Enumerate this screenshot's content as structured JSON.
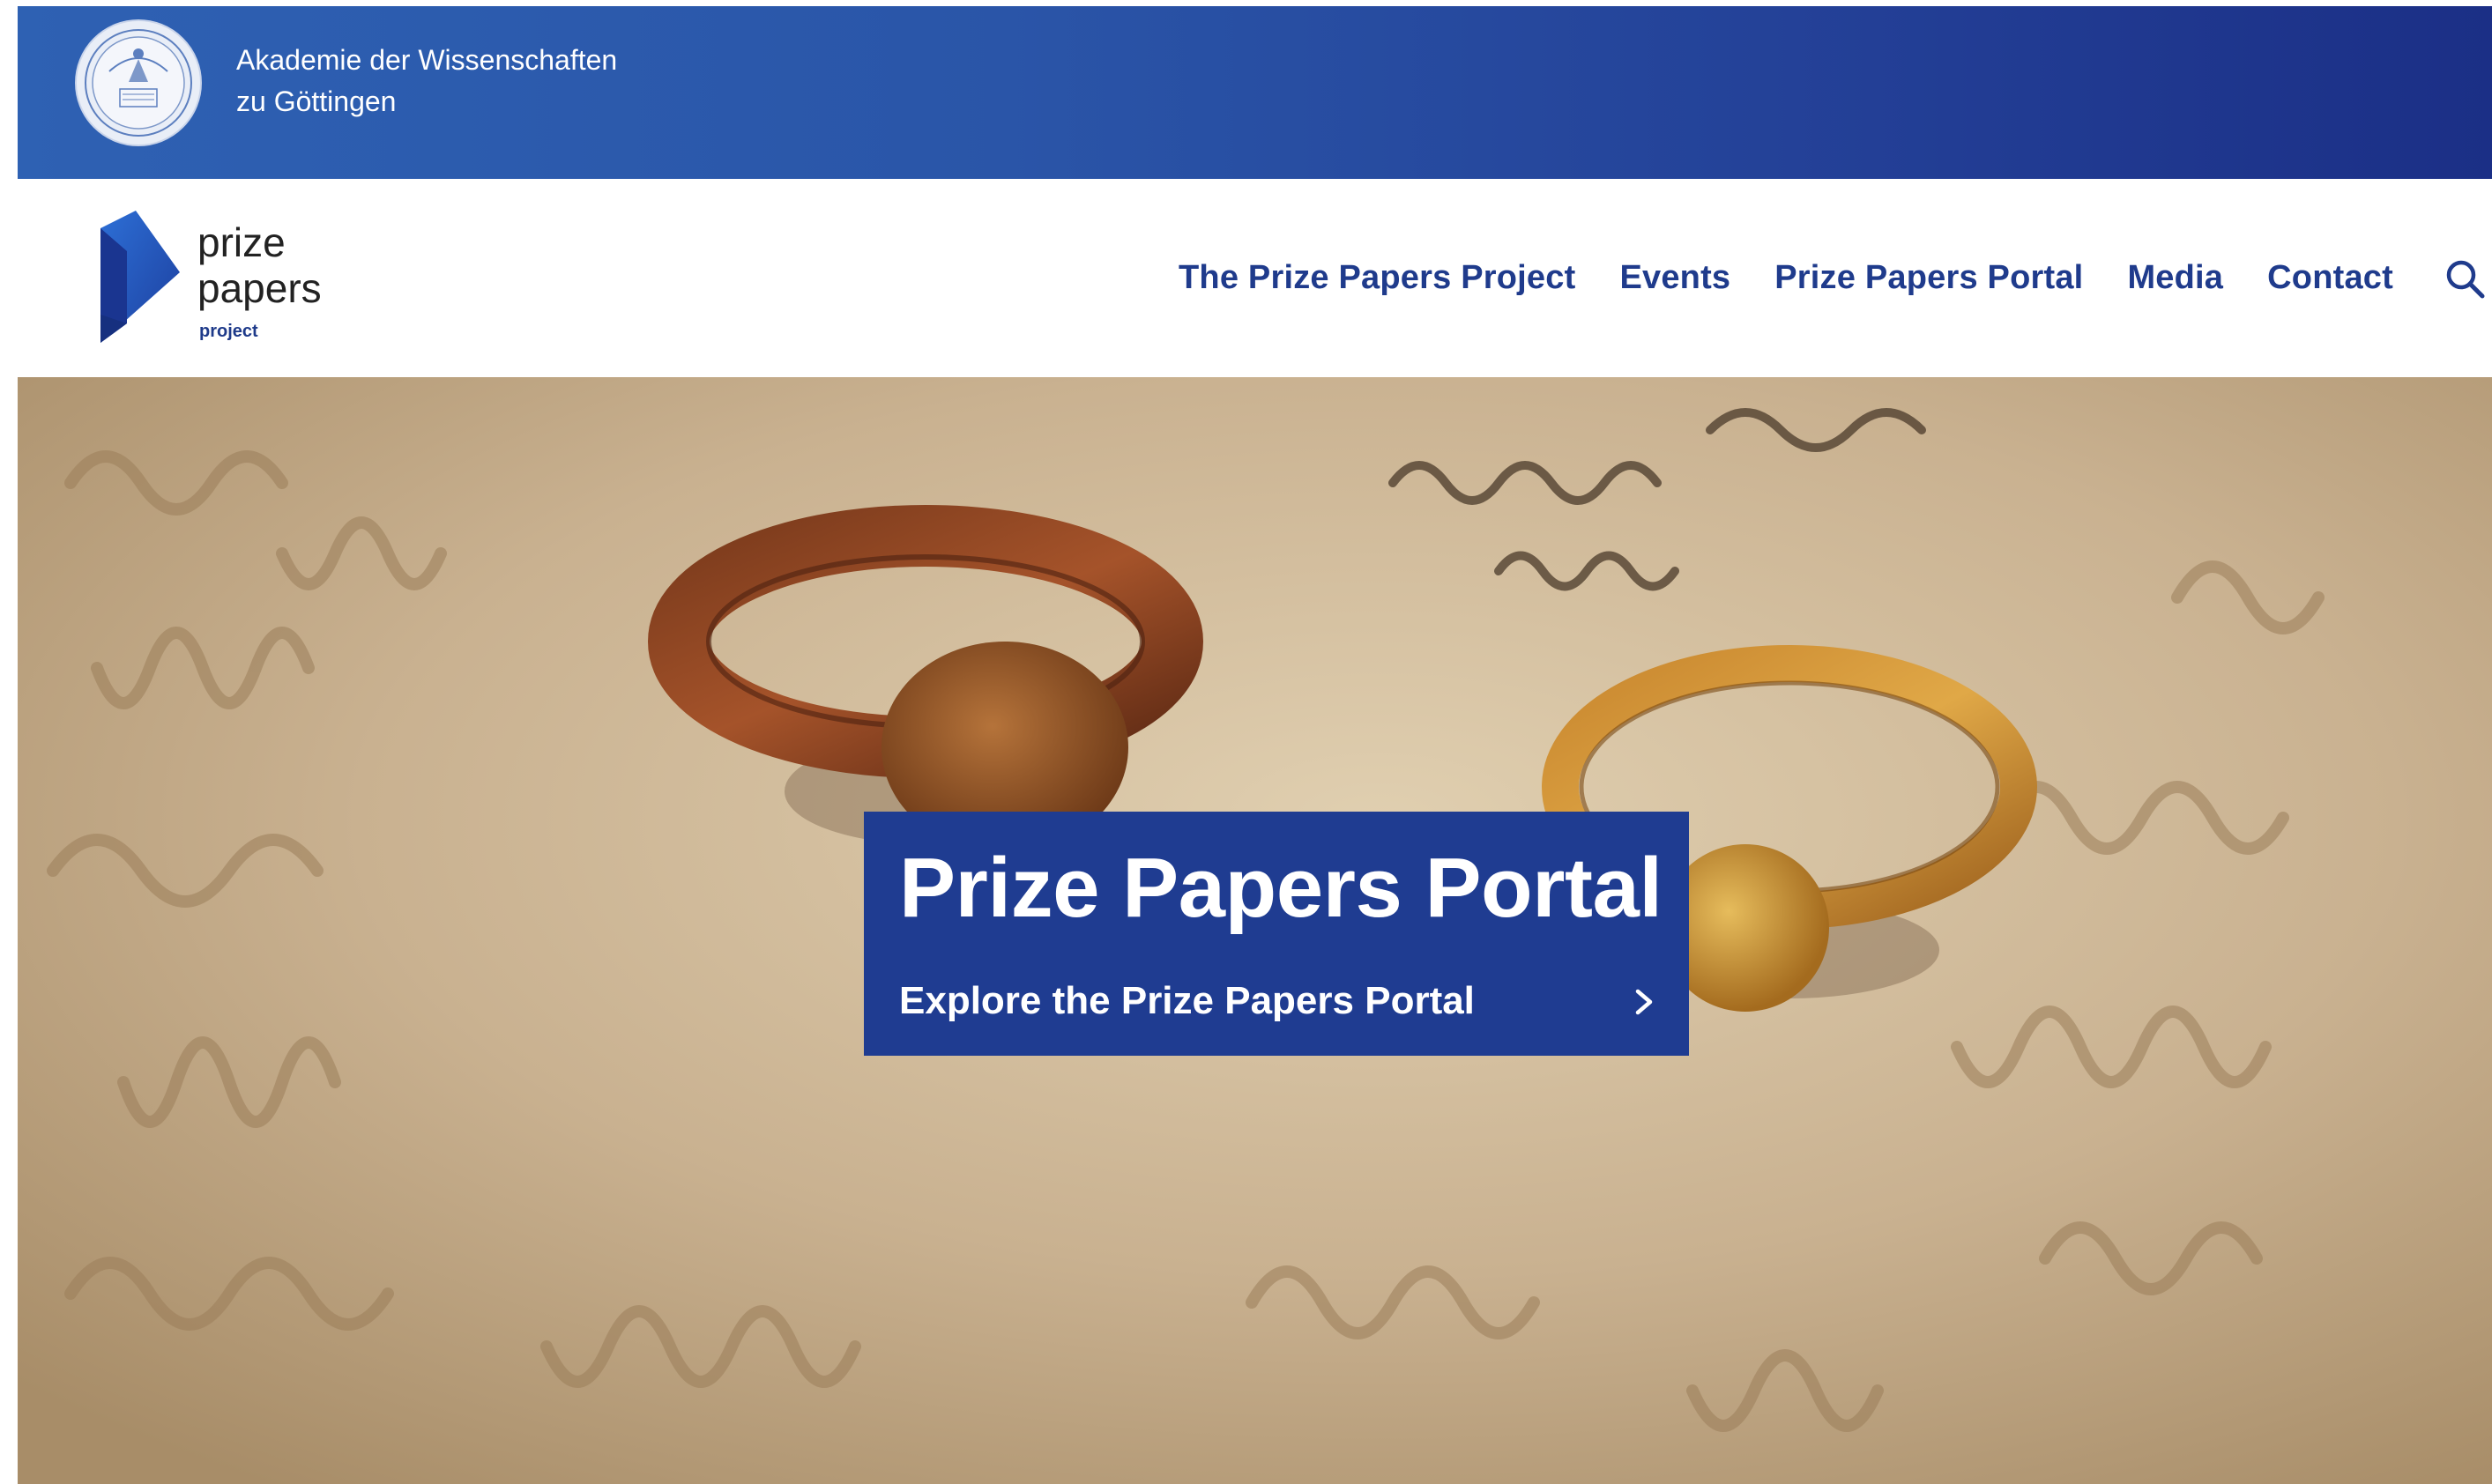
{
  "academy_bar": {
    "name_line1": "Akademie der Wissenschaften",
    "name_line2": "zu Göttingen",
    "seal_icon": "academy-seal-icon",
    "gradient_start": "#2e61b3",
    "gradient_end": "#1b2f86"
  },
  "header": {
    "logo": {
      "word_line1": "prize",
      "word_line2": "papers",
      "sub": "project",
      "mark_icon": "prize-papers-logo-mark"
    },
    "nav": [
      {
        "label": "The Prize Papers Project"
      },
      {
        "label": "Events"
      },
      {
        "label": "Prize Papers Portal"
      },
      {
        "label": "Media"
      },
      {
        "label": "Contact"
      }
    ],
    "search_icon": "search-icon",
    "nav_color": "#1f3b8c"
  },
  "hero": {
    "image_subject": "two-rings-on-handwritten-letter",
    "portal_box": {
      "title": "Prize Papers Portal",
      "link_text": "Explore the Prize Papers Portal",
      "chevron_icon": "chevron-right-icon",
      "background": "#1f3c91"
    }
  }
}
